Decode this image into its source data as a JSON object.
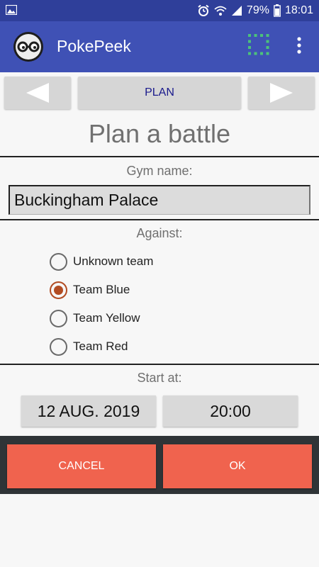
{
  "status_bar": {
    "battery": "79%",
    "time": "18:01",
    "icons": [
      "image-icon",
      "alarm-icon",
      "wifi-icon",
      "signal-icon",
      "battery-icon"
    ]
  },
  "app": {
    "title": "PokePeek",
    "icons": [
      "app-logo-icon",
      "grid-icon",
      "more-vert-icon"
    ]
  },
  "nav": {
    "plan_label": "PLAN",
    "icons": [
      "arrow-left-icon",
      "arrow-right-icon"
    ]
  },
  "page": {
    "title": "Plan a battle"
  },
  "gym": {
    "label": "Gym name:",
    "value": "Buckingham Palace"
  },
  "against": {
    "label": "Against:",
    "options": [
      {
        "label": "Unknown team",
        "checked": false
      },
      {
        "label": "Team Blue",
        "checked": true
      },
      {
        "label": "Team Yellow",
        "checked": false
      },
      {
        "label": "Team Red",
        "checked": false
      }
    ]
  },
  "start": {
    "label": "Start at:",
    "date": "12 AUG. 2019",
    "time": "20:00"
  },
  "actions": {
    "cancel": "CANCEL",
    "ok": "OK"
  },
  "colors": {
    "appbar": "#3f51b5",
    "accent": "#f0634e",
    "radio_checked": "#b24c23"
  }
}
